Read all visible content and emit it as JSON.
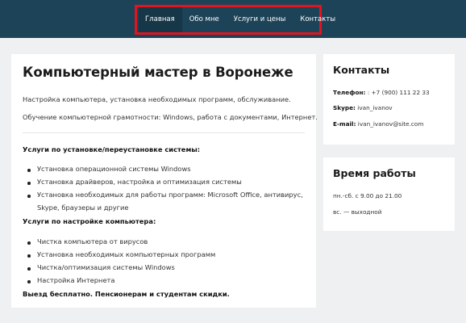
{
  "nav": {
    "items": [
      {
        "label": "Главная",
        "active": true
      },
      {
        "label": "Обо мне",
        "active": false
      },
      {
        "label": "Услуги и цены",
        "active": false
      },
      {
        "label": "Контакты",
        "active": false
      }
    ],
    "highlight_color": "#e2151f",
    "bar_color": "#1d4358"
  },
  "main": {
    "title": "Компьютерный мастер в Воронеже",
    "intro1": "Настройка компьютера, установка необходимых программ, обслуживание.",
    "intro2": "Обучение компьютерной грамотности: Windows, работа с документами, Интернет.",
    "section1": {
      "heading": "Услуги по установке/переустановке системы:",
      "items": [
        "Установка операционной системы Windows",
        "Установка драйверов, настройка и оптимизация системы",
        "Установка необходимых для работы программ: Microsoft Office, антивирус,",
        "Skype, браузеры и другие"
      ]
    },
    "section2": {
      "heading": "Услуги по настройке компьютера:",
      "items": [
        "Чистка компьютера от вирусов",
        "Установка необходимых компьютерных программ",
        "Чистка/оптимизация системы Windows",
        "Настройка Интернета"
      ]
    },
    "footer_note": "Выезд бесплатно. Пенсионерам и студентам скидки."
  },
  "contacts": {
    "title": "Контакты",
    "phone_label": "Телефон:",
    "phone_value": ": +7 (900) 111 22 33",
    "skype_label": "Skype:",
    "skype_value": "ivan_ivanov",
    "email_label": "E-mail:",
    "email_value": "ivan_ivanov@site.com"
  },
  "hours": {
    "title": "Время работы",
    "line1": "пн.-сб. с 9.00 до 21.00",
    "line2": "вс. — выходной"
  }
}
